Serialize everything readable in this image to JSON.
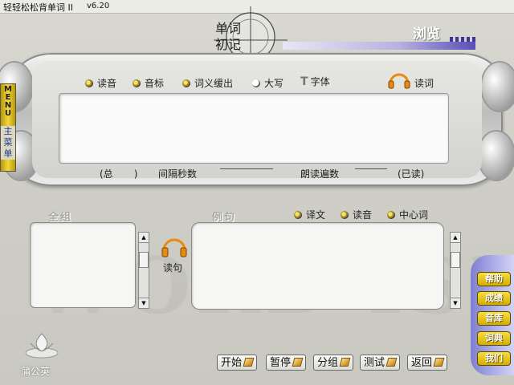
{
  "title": {
    "app_name": "轻轻松松背单词 II",
    "version": "v6.20"
  },
  "header": {
    "word_label_line1": "单词",
    "word_label_line2": "初记",
    "browse_label": "浏览"
  },
  "menu": {
    "en": "MENU",
    "cn": "主菜单"
  },
  "top_options": [
    {
      "label": "读音",
      "checked": true
    },
    {
      "label": "音标",
      "checked": true
    },
    {
      "label": "词义缓出",
      "checked": true
    },
    {
      "label": "大写",
      "checked": false
    }
  ],
  "font_label": "字体",
  "read_word_label": "读词",
  "stats": {
    "total_open": "(总",
    "total_close": ")",
    "interval_label": "间隔秒数",
    "repeat_label": "朗读遍数",
    "read_label": "(已读)"
  },
  "sections": {
    "group_label": "全组",
    "example_label": "例句"
  },
  "example_options": [
    {
      "label": "译文",
      "checked": true
    },
    {
      "label": "读音",
      "checked": true
    },
    {
      "label": "中心词",
      "checked": true
    }
  ],
  "read_sentence_label": "读句",
  "side_buttons": [
    "帮助",
    "成绩",
    "音库",
    "词典",
    "我们"
  ],
  "bottom_buttons": [
    "开始",
    "暂停",
    "分组",
    "测试",
    "返回"
  ],
  "logo_text": "蒲公英",
  "watermark": "WORD ISLAND",
  "colors": {
    "accent_yellow": "#f3d640",
    "accent_purple": "#5a4fb5",
    "headphone_orange": "#e88a10"
  }
}
